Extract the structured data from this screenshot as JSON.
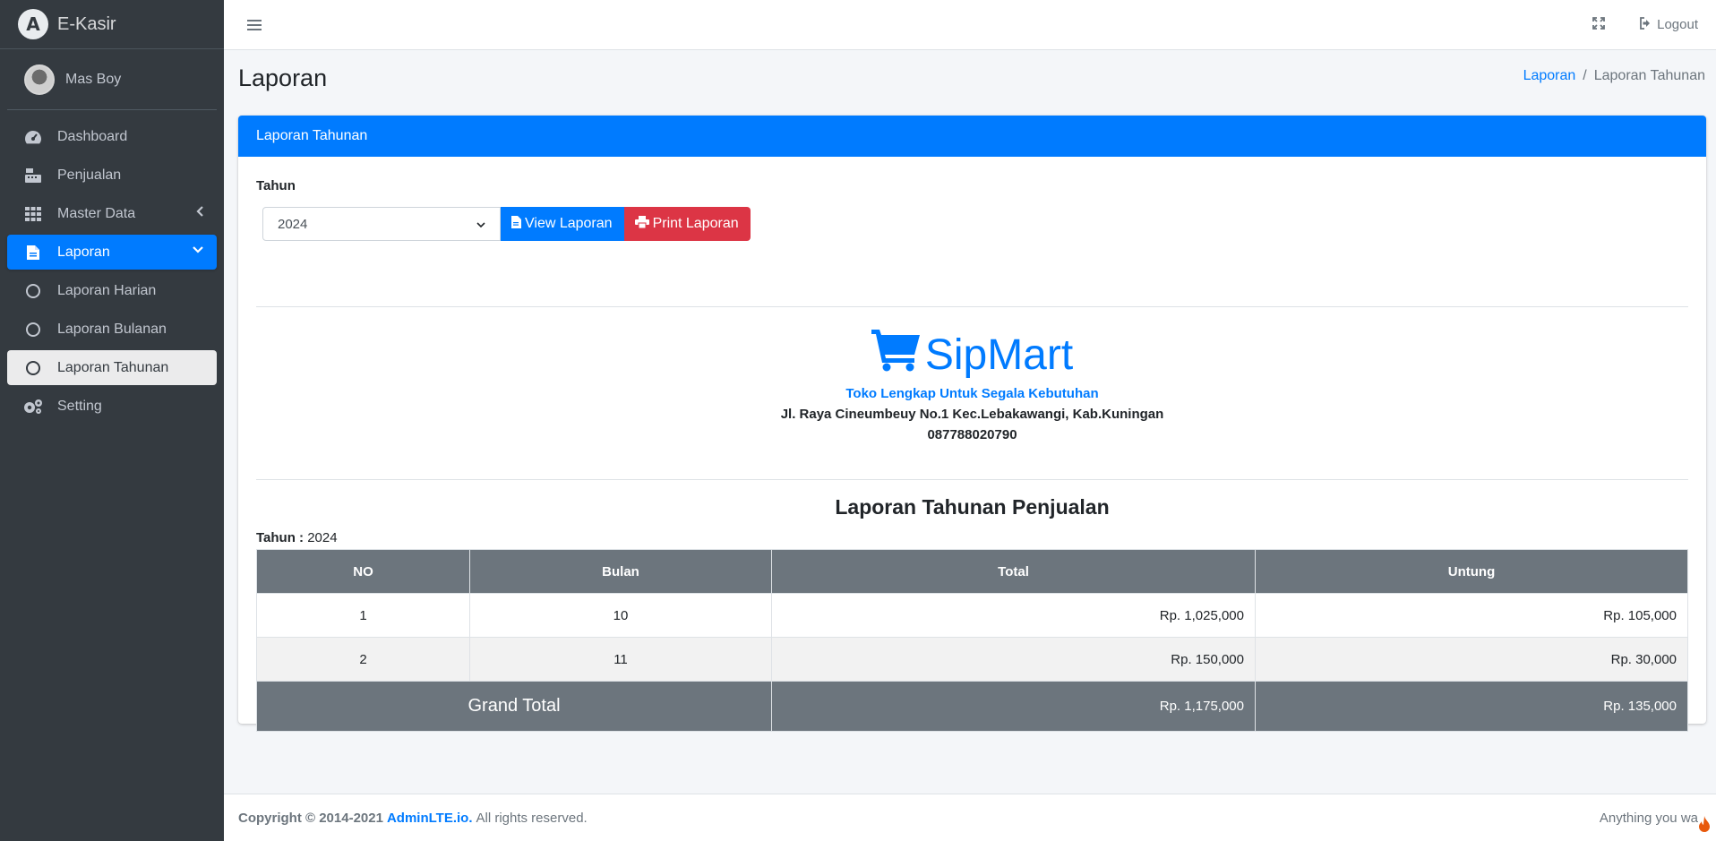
{
  "brand": {
    "name": "E-Kasir",
    "logo_letter": "A"
  },
  "user": {
    "name": "Mas Boy"
  },
  "sidebar": {
    "items": [
      {
        "label": "Dashboard",
        "icon": "tachometer-icon"
      },
      {
        "label": "Penjualan",
        "icon": "cash-register-icon"
      },
      {
        "label": "Master Data",
        "icon": "grid-icon"
      },
      {
        "label": "Laporan",
        "icon": "file-icon"
      },
      {
        "label": "Laporan Harian",
        "icon": "circle-icon"
      },
      {
        "label": "Laporan Bulanan",
        "icon": "circle-icon"
      },
      {
        "label": "Laporan Tahunan",
        "icon": "circle-icon"
      },
      {
        "label": "Setting",
        "icon": "gears-icon"
      }
    ]
  },
  "topnav": {
    "logout_label": "Logout"
  },
  "header": {
    "title": "Laporan",
    "breadcrumb": {
      "link": "Laporan",
      "separator": "/",
      "current": "Laporan Tahunan"
    }
  },
  "card": {
    "title": "Laporan Tahunan",
    "form": {
      "label": "Tahun",
      "selected_year": "2024",
      "view_button": "View Laporan",
      "print_button": "Print Laporan"
    },
    "store": {
      "name": "SipMart",
      "tagline": "Toko Lengkap Untuk Segala Kebutuhan",
      "address": "Jl. Raya Cineumbeuy No.1 Kec.Lebakawangi, Kab.Kuningan",
      "phone": "087788020790"
    },
    "report": {
      "title": "Laporan Tahunan Penjualan",
      "year_label": "Tahun :",
      "year_value": "2024",
      "columns": [
        "NO",
        "Bulan",
        "Total",
        "Untung"
      ],
      "rows": [
        {
          "no": "1",
          "bulan": "10",
          "total": "Rp. 1,025,000",
          "untung": "Rp. 105,000"
        },
        {
          "no": "2",
          "bulan": "11",
          "total": "Rp. 150,000",
          "untung": "Rp. 30,000"
        }
      ],
      "grand_total_label": "Grand Total",
      "grand_total": "Rp. 1,175,000",
      "grand_untung": "Rp. 135,000"
    }
  },
  "footer": {
    "copyright_prefix": "Copyright © 2014-2021",
    "link": "AdminLTE.io.",
    "suffix": "All rights reserved.",
    "right_text": "Anything you wa"
  },
  "colors": {
    "primary": "#007bff",
    "danger": "#dc3545",
    "sidebar": "#343a40",
    "table_head": "#6c757d"
  }
}
